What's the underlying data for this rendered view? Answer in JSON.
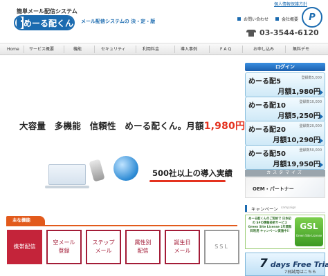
{
  "header": {
    "tagline": "簡単メール配信システム",
    "logo_text": "めーる配くん",
    "catch": "メール配信システムの 決・定・版",
    "privacy_link": "個人情報保護方針",
    "pmark_label": "P",
    "inquiry_link": "お問い合わせ",
    "company_link": "会社概要",
    "phone": "03-3544-6120"
  },
  "nav": {
    "items": [
      "Home",
      "サービス概要",
      "機能",
      "セキュリティ",
      "利用料金",
      "導入事例",
      "F A Q",
      "お申し込み",
      "無料デモ"
    ]
  },
  "hero": {
    "headline": "大容量　多機能　信頼性　めーる配くん。月額",
    "price": "1,980円",
    "tilde": "〜",
    "record": "500社以上の導入実績"
  },
  "sidebar": {
    "login_label": "ログイン",
    "plans": [
      {
        "name": "めーる配5",
        "users": "登録数5,000",
        "price": "月額1,980円"
      },
      {
        "name": "めーる配10",
        "users": "登録数10,000",
        "price": "月額5,250円"
      },
      {
        "name": "めーる配20",
        "users": "登録数20,000",
        "price": "月額10,290円"
      },
      {
        "name": "めーる配50",
        "users": "登録数50,000",
        "price": "月額19,950円"
      }
    ],
    "customize_label": "カスタマイズ",
    "oem_label": "OEM・パートナー",
    "campaign_title": "キャンペーン",
    "campaign_en": "campaign",
    "campaign_text": "めーる配くんのご契約で 日本初の SFの情報技術サービス Green Site License 1年間無料利用 キャンペーン実施中!!",
    "gsl_title": "GSL",
    "gsl_sub": "Green Site License",
    "trial_days": "7",
    "trial_text": "days Free Trial",
    "trial_sub": "7日試用はこちら"
  },
  "features": {
    "label": "主な機能",
    "items": [
      "携帯配信",
      "空メール 登録",
      "ステップ メール",
      "属性別 配信",
      "誕生日 メール",
      "SSL"
    ]
  },
  "colors": {
    "brand_blue": "#1b6bb0",
    "accent_red": "#e4321f",
    "feature_red": "#a31c37",
    "feature_label_orange": "#e25a1c"
  }
}
